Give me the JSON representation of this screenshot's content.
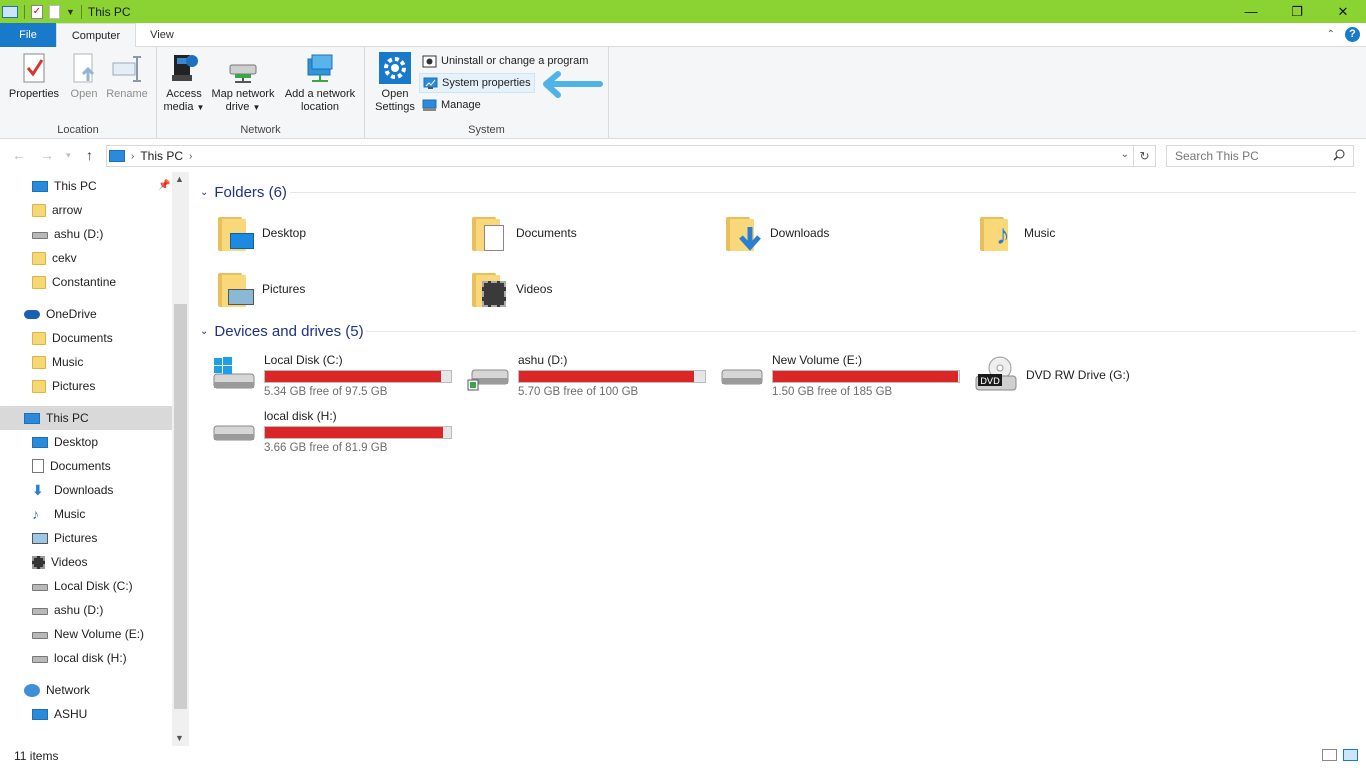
{
  "window": {
    "title": "This PC",
    "accent": "#8ad332",
    "controls": {
      "minimize": "—",
      "maximize": "❐",
      "close": "✕"
    }
  },
  "tabs": {
    "file": "File",
    "computer": "Computer",
    "view": "View",
    "help": "?"
  },
  "ribbon": {
    "location": {
      "label": "Location",
      "properties": "Properties",
      "open": "Open",
      "rename": "Rename"
    },
    "network": {
      "label": "Network",
      "access_media_1": "Access",
      "access_media_2": "media",
      "map_drive_1": "Map network",
      "map_drive_2": "drive",
      "add_location_1": "Add a network",
      "add_location_2": "location"
    },
    "system": {
      "label": "System",
      "open_settings_1": "Open",
      "open_settings_2": "Settings",
      "uninstall": "Uninstall or change a program",
      "system_properties": "System properties",
      "manage": "Manage"
    }
  },
  "address": {
    "crumb": "This PC",
    "search_placeholder": "Search This PC"
  },
  "navpane": {
    "quick_access": [
      "This PC",
      "arrow",
      "ashu (D:)",
      "cekv",
      "Constantine"
    ],
    "onedrive": {
      "label": "OneDrive",
      "items": [
        "Documents",
        "Music",
        "Pictures"
      ]
    },
    "this_pc": {
      "label": "This PC",
      "items": [
        "Desktop",
        "Documents",
        "Downloads",
        "Music",
        "Pictures",
        "Videos",
        "Local Disk (C:)",
        "ashu (D:)",
        "New Volume (E:)",
        "local disk (H:)"
      ]
    },
    "network": {
      "label": "Network",
      "items": [
        "ASHU"
      ]
    }
  },
  "folders": {
    "header": "Folders (6)",
    "items": [
      "Desktop",
      "Documents",
      "Downloads",
      "Music",
      "Pictures",
      "Videos"
    ]
  },
  "drives": {
    "header": "Devices and drives (5)",
    "items": [
      {
        "name": "Local Disk (C:)",
        "free": "5.34 GB free of 97.5 GB",
        "used_fraction": 0.945
      },
      {
        "name": "ashu (D:)",
        "free": "5.70 GB free of 100 GB",
        "used_fraction": 0.943
      },
      {
        "name": "New Volume (E:)",
        "free": "1.50 GB free of 185 GB",
        "used_fraction": 0.992
      },
      {
        "name": "DVD RW Drive (G:)",
        "free": "",
        "used_fraction": null,
        "badge": "DVD"
      },
      {
        "name": "local disk (H:)",
        "free": "3.66 GB free of 81.9 GB",
        "used_fraction": 0.955
      }
    ]
  },
  "status": {
    "text": "11 items"
  },
  "colors": {
    "bar_fill": "#da2626",
    "selection": "#d9d9d9",
    "file_tab": "#1979ca",
    "header_text": "#1e3287"
  }
}
